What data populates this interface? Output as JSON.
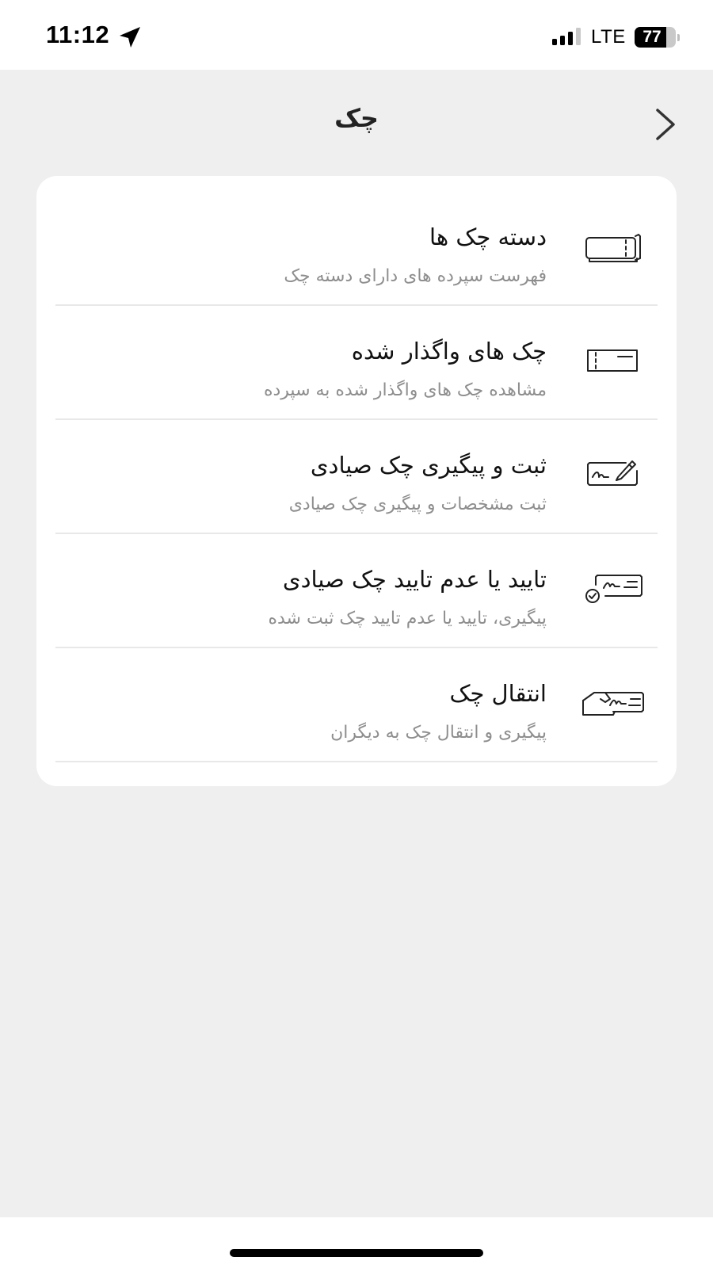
{
  "status_bar": {
    "time": "11:12",
    "network": "LTE",
    "battery_level": "77",
    "battery_percent": 77
  },
  "header": {
    "title": "چک"
  },
  "menu": [
    {
      "title": "دسته چک ها",
      "subtitle": "فهرست سپرده های دارای دسته چک",
      "icon": "checkbook-icon"
    },
    {
      "title": "چک های واگذار شده",
      "subtitle": "مشاهده چک های واگذار شده به سپرده",
      "icon": "cheque-icon"
    },
    {
      "title": "ثبت و پیگیری چک صیادی",
      "subtitle": "ثبت مشخصات و پیگیری چک صیادی",
      "icon": "sign-cheque-icon"
    },
    {
      "title": "تایید یا عدم تایید چک صیادی",
      "subtitle": "پیگیری، تایید یا عدم تایید چک ثبت شده",
      "icon": "verify-cheque-icon"
    },
    {
      "title": "انتقال چک",
      "subtitle": "پیگیری و انتقال چک به دیگران",
      "icon": "transfer-cheque-icon"
    }
  ],
  "colors": {
    "background": "#efefef",
    "card": "#ffffff",
    "title_text": "#111111",
    "subtitle_text": "#8e8e8e",
    "divider": "#e8e8e8"
  }
}
